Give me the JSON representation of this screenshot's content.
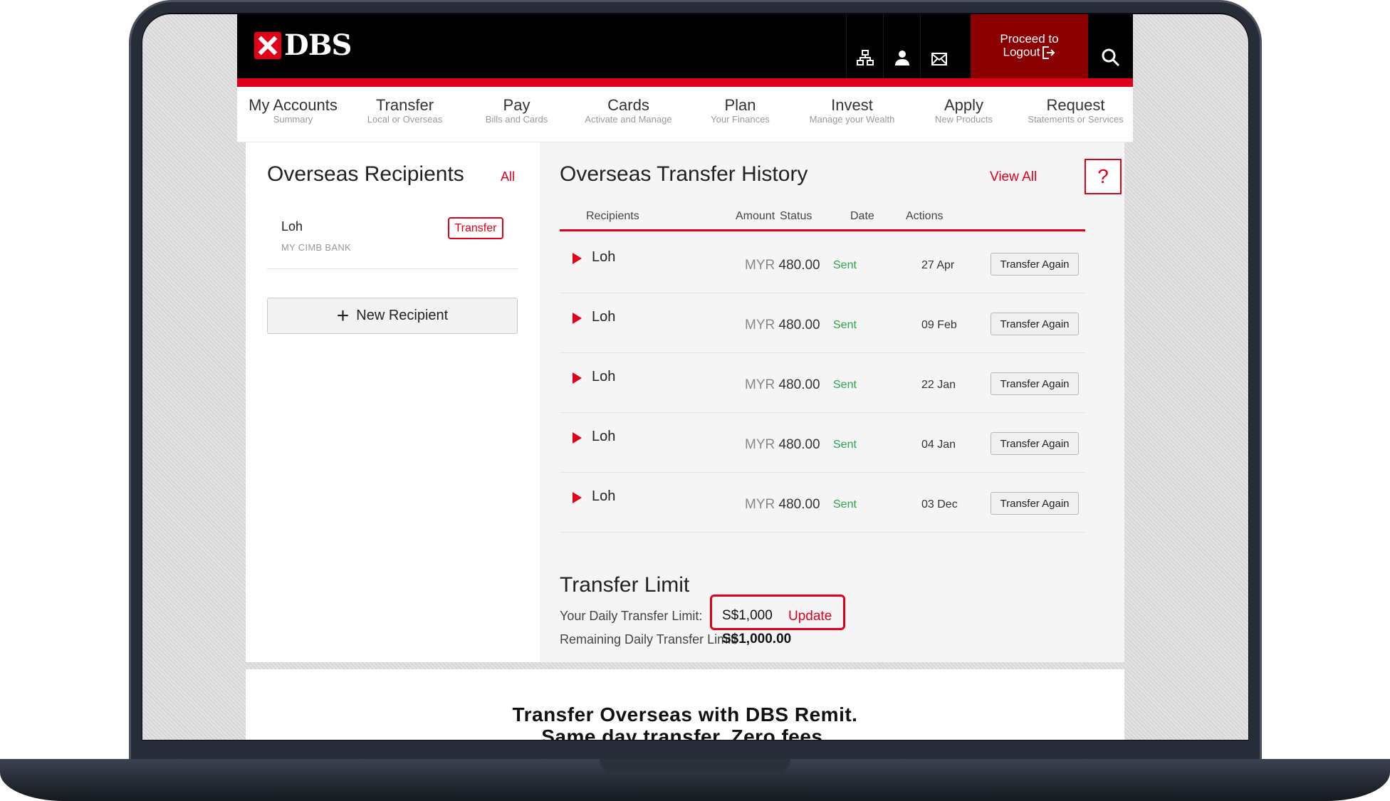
{
  "brand": {
    "name": "DBS",
    "accent": "#e1001a",
    "dark_red": "#8b0000"
  },
  "topbar": {
    "icons": [
      "sitemap-icon",
      "user-icon",
      "mail-icon"
    ],
    "logout_line1": "Proceed to",
    "logout_line2": "Logout",
    "search_icon": "search-icon"
  },
  "nav": [
    {
      "title": "My Accounts",
      "sub": "Summary"
    },
    {
      "title": "Transfer",
      "sub": "Local or Overseas"
    },
    {
      "title": "Pay",
      "sub": "Bills and Cards"
    },
    {
      "title": "Cards",
      "sub": "Activate and Manage"
    },
    {
      "title": "Plan",
      "sub": "Your Finances"
    },
    {
      "title": "Invest",
      "sub": "Manage your Wealth"
    },
    {
      "title": "Apply",
      "sub": "New Products"
    },
    {
      "title": "Request",
      "sub": "Statements or Services"
    }
  ],
  "recipients": {
    "title": "Overseas Recipients",
    "all_link": "All",
    "items": [
      {
        "name": "Loh",
        "bank": "MY CIMB BANK",
        "button": "Transfer"
      }
    ],
    "new_button": "New Recipient"
  },
  "history": {
    "title": "Overseas Transfer History",
    "view_all": "View All",
    "help": "?",
    "columns": {
      "recipients": "Recipients",
      "amount": "Amount",
      "status": "Status",
      "date": "Date",
      "actions": "Actions"
    },
    "rows": [
      {
        "name": "Loh",
        "currency": "MYR",
        "amount": "480.00",
        "status": "Sent",
        "date": "27 Apr",
        "action": "Transfer Again"
      },
      {
        "name": "Loh",
        "currency": "MYR",
        "amount": "480.00",
        "status": "Sent",
        "date": "09 Feb",
        "action": "Transfer Again"
      },
      {
        "name": "Loh",
        "currency": "MYR",
        "amount": "480.00",
        "status": "Sent",
        "date": "22 Jan",
        "action": "Transfer Again"
      },
      {
        "name": "Loh",
        "currency": "MYR",
        "amount": "480.00",
        "status": "Sent",
        "date": "04 Jan",
        "action": "Transfer Again"
      },
      {
        "name": "Loh",
        "currency": "MYR",
        "amount": "480.00",
        "status": "Sent",
        "date": "03 Dec",
        "action": "Transfer Again"
      }
    ]
  },
  "limit": {
    "title": "Transfer Limit",
    "daily_label": "Your Daily Transfer Limit:",
    "daily_value": "S$1,000",
    "update": "Update",
    "remaining_label": "Remaining Daily Transfer Limit:",
    "remaining_value": "S$1,000.00"
  },
  "promo": {
    "line1": "Transfer Overseas with DBS Remit.",
    "line2": "Same day transfer. Zero fees."
  }
}
